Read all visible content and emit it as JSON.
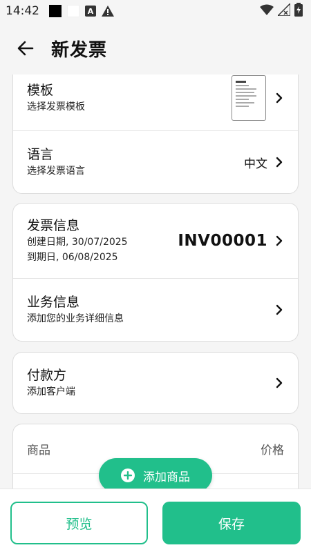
{
  "status_bar": {
    "time": "14:42",
    "icons": [
      "black-square-icon",
      "white-square-icon",
      "a-box-icon",
      "warning-icon",
      "wifi-icon",
      "no-signal-icon",
      "battery-charging-icon"
    ]
  },
  "appbar": {
    "title": "新发票",
    "back_icon": "arrow-back-icon"
  },
  "template_card": {
    "template_row": {
      "title": "模板",
      "subtitle": "选择发票模板"
    },
    "language_row": {
      "title": "语言",
      "subtitle": "选择发票语言",
      "value": "中文"
    }
  },
  "invoice_card": {
    "invoice_row": {
      "title": "发票信息",
      "created": "创建日期, 30/07/2025",
      "due": "到期日, 06/08/2025",
      "number": "INV00001"
    },
    "business_row": {
      "title": "业务信息",
      "subtitle": "添加您的业务详细信息"
    }
  },
  "payer_card": {
    "payer_row": {
      "title": "付款方",
      "subtitle": "添加客户端"
    }
  },
  "products_card": {
    "col_product": "商品",
    "col_price": "价格"
  },
  "add_product_button": {
    "label": "添加商品",
    "icon": "plus-circle-icon"
  },
  "bottom_bar": {
    "preview_label": "预览",
    "save_label": "保存"
  },
  "colors": {
    "accent": "#21bf8b",
    "background": "#f5f5f5"
  }
}
